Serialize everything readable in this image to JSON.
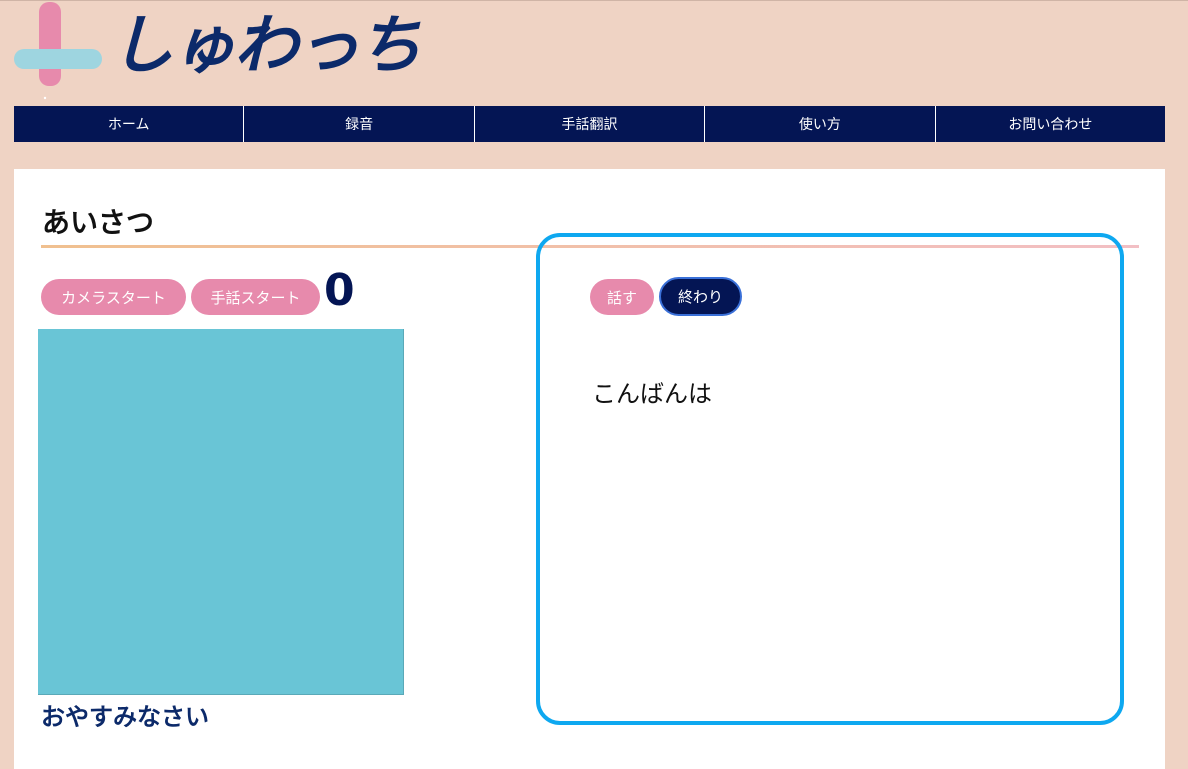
{
  "logo": {
    "text": "しゅわっち",
    "icon": "plus-logo-icon",
    "colors": {
      "pink": "#e78aac",
      "blue": "#9ed5e0",
      "text": "#0c2a6a"
    }
  },
  "nav": {
    "items": [
      {
        "label": "ホーム"
      },
      {
        "label": "録音"
      },
      {
        "label": "手話翻訳"
      },
      {
        "label": "使い方"
      },
      {
        "label": "お問い合わせ"
      }
    ]
  },
  "section": {
    "title": "あいさつ"
  },
  "camera": {
    "start_label": "カメラスタート",
    "sign_start_label": "手話スタート",
    "count": "0"
  },
  "result": {
    "label": "おやすみなさい"
  },
  "speech": {
    "talk_label": "話す",
    "end_label": "終わり",
    "text": "こんばんは"
  },
  "colors": {
    "background": "#efd3c4",
    "nav": "#041554",
    "pill": "#e78aac",
    "panel_border": "#0ea8f0",
    "camera": "#69c5d6"
  }
}
